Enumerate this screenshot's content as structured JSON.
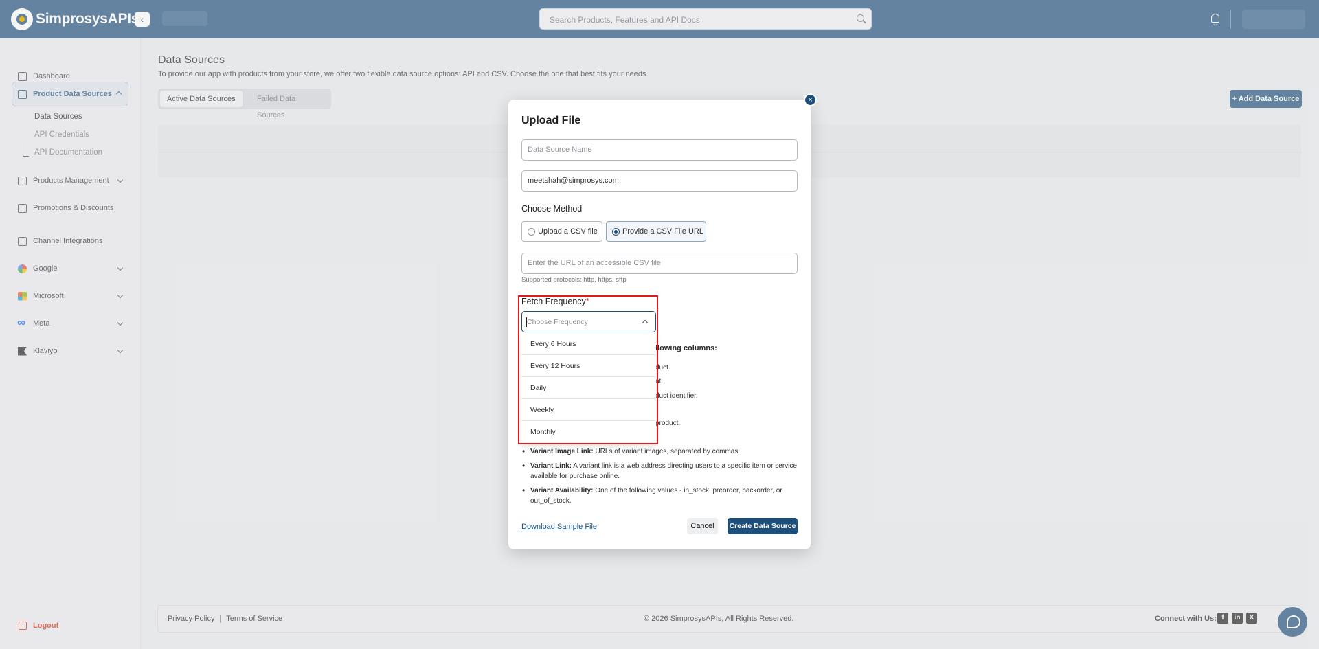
{
  "brand": {
    "name": "SimprosysAPIs"
  },
  "search": {
    "placeholder": "Search Products, Features and API Docs"
  },
  "sidebar": {
    "items": [
      {
        "label": "Dashboard"
      },
      {
        "label": "Product Data Sources"
      },
      {
        "label": "Products Management"
      },
      {
        "label": "Promotions & Discounts"
      },
      {
        "label": "Channel Integrations"
      },
      {
        "label": "Google"
      },
      {
        "label": "Microsoft"
      },
      {
        "label": "Meta"
      },
      {
        "label": "Klaviyo"
      }
    ],
    "subitems": [
      {
        "label": "Data Sources"
      },
      {
        "label": "API Credentials"
      },
      {
        "label": "API Documentation"
      }
    ],
    "logout": "Logout"
  },
  "page": {
    "title": "Data Sources",
    "description": "To provide our app with products from your store, we offer two flexible data source options: API and CSV. Choose the one that best fits your needs.",
    "tabs": [
      "Active Data Sources",
      "Failed Data Sources"
    ],
    "add_button": "+ Add Data Source"
  },
  "modal": {
    "title": "Upload File",
    "close": "×",
    "name_placeholder": "Data Source Name",
    "email_value": "meetshah@simprosys.com",
    "choose_method_label": "Choose Method",
    "methods": [
      {
        "label": "Upload a CSV file",
        "selected": false
      },
      {
        "label": "Provide a CSV File URL",
        "selected": true
      }
    ],
    "url_placeholder": "Enter the URL of an accessible CSV file",
    "url_help": "Supported protocols: http, https, sftp",
    "fetch_label": "Fetch Frequency",
    "required_mark": "*",
    "frequency_placeholder": "Choose Frequency",
    "frequency_options": [
      "Every 6 Hours",
      "Every 12 Hours",
      "Daily",
      "Weekly",
      "Monthly"
    ],
    "partial_lines": [
      "llowing columns:",
      "duct.",
      "nt.",
      "duct identifier.",
      "product."
    ],
    "bullets": [
      {
        "term": "Variant Image Link:",
        "text": " URLs of variant images, separated by commas."
      },
      {
        "term": "Variant Link:",
        "text": " A variant link is a web address directing users to a specific item or service available for purchase online."
      },
      {
        "term": "Variant Availability:",
        "text": " One of the following values - in_stock, preorder, backorder, or out_of_stock."
      }
    ],
    "download_link": "Download Sample File",
    "cancel": "Cancel",
    "create": "Create Data Source"
  },
  "footer": {
    "privacy": "Privacy Policy",
    "separator": "|",
    "terms": "Terms of Service",
    "copyright": "© 2026 SimprosysAPIs, All Rights Reserved.",
    "connect": "Connect with Us:",
    "social": [
      "f",
      "in",
      "X"
    ]
  },
  "colors": {
    "primary": "#1e4f7a",
    "danger": "#d72c0d",
    "highlight": "#e0191b"
  }
}
